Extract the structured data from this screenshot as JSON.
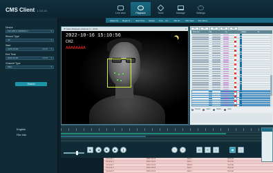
{
  "app": {
    "title": "CMS Client",
    "version": "1.3.6.16"
  },
  "nav": [
    {
      "label": "Live view",
      "icon": "live-view-icon",
      "active": false
    },
    {
      "label": "Playback",
      "icon": "playback-icon",
      "active": true
    },
    {
      "label": "Tools",
      "icon": "tools-icon",
      "active": false
    },
    {
      "label": "Manage",
      "icon": "manage-icon",
      "active": false
    },
    {
      "label": "Settings",
      "icon": "settings-icon",
      "active": false
    }
  ],
  "stream_header": {
    "cells": [
      "Wake No",
      "Begin Ti...",
      "End Time",
      "Status",
      "Proc... Co...",
      "File Si...",
      "File Type",
      "File Name"
    ]
  },
  "left_panel": {
    "fields": [
      {
        "label": "Device",
        "value": "192.168.1.100/8000 V..."
      },
      {
        "label": "Record Type",
        "value": "All"
      },
      {
        "label": "Start",
        "value": "2022-10-06",
        "suffix": "00:00"
      },
      {
        "label": "End Time",
        "value": "2022-10-06",
        "suffix": "23:59"
      },
      {
        "label": "Channel Type",
        "value": "Main"
      }
    ],
    "search_label": "Search",
    "footer": [
      "English",
      "File Info"
    ]
  },
  "playback_window": {
    "title": "IP video Playback (channel 1) - 01/01",
    "osd_time": "2022-10-16 15:10:56",
    "osd_channel": "CH2",
    "osd_name": "AAAAAAAA"
  },
  "right_panel": {
    "tools": [
      "Up",
      "Dn",
      "All",
      "Exp",
      "Del"
    ],
    "headers": [
      "Time No.",
      "File",
      "Ty...",
      "Status",
      "Si..."
    ],
    "selected_rows": [
      25,
      26,
      27,
      28,
      29,
      30,
      31
    ],
    "row_count": 32,
    "legend": [
      {
        "label": "Normal",
        "color": "#ffffff"
      },
      {
        "label": "Alarm",
        "color": "#ff3b3b"
      },
      {
        "label": "Motion",
        "color": "#2aa5c0"
      },
      {
        "label": "Other",
        "color": "#d23a3a"
      }
    ]
  },
  "bottom_table": {
    "rows": [
      [
        "Camera 1",
        "2022-10-16",
        "Alarm",
        "Normal"
      ],
      [
        "Camera 2",
        "2022-10-16",
        "Alarm",
        "Normal"
      ],
      [
        "Camera 3",
        "2022-10-16",
        "Motion",
        "Normal"
      ],
      [
        "Camera 4",
        "2022-10-16",
        "Alarm",
        "Normal"
      ],
      [
        "Camera 5",
        "2022-10-16",
        "Alarm",
        "Normal"
      ]
    ]
  },
  "colors": {
    "background": "#0c1e28",
    "accent": "#1a6b84",
    "highlight": "#2aa5c0",
    "face_box": "#d6f23a",
    "osd_red": "#ff2a2a"
  }
}
